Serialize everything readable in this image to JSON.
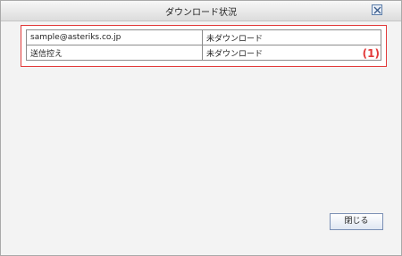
{
  "window": {
    "title": "ダウンロード状況"
  },
  "rows": [
    {
      "name": "sample@asteriks.co.jp",
      "status": "未ダウンロード"
    },
    {
      "name": "送信控え",
      "status": "未ダウンロード"
    }
  ],
  "annotation": "(1)",
  "footer": {
    "close_label": "閉じる"
  },
  "colors": {
    "highlight": "#e23a3a",
    "title_bar": "#e6e6e6"
  },
  "icons": {
    "close": "close-x-icon"
  }
}
